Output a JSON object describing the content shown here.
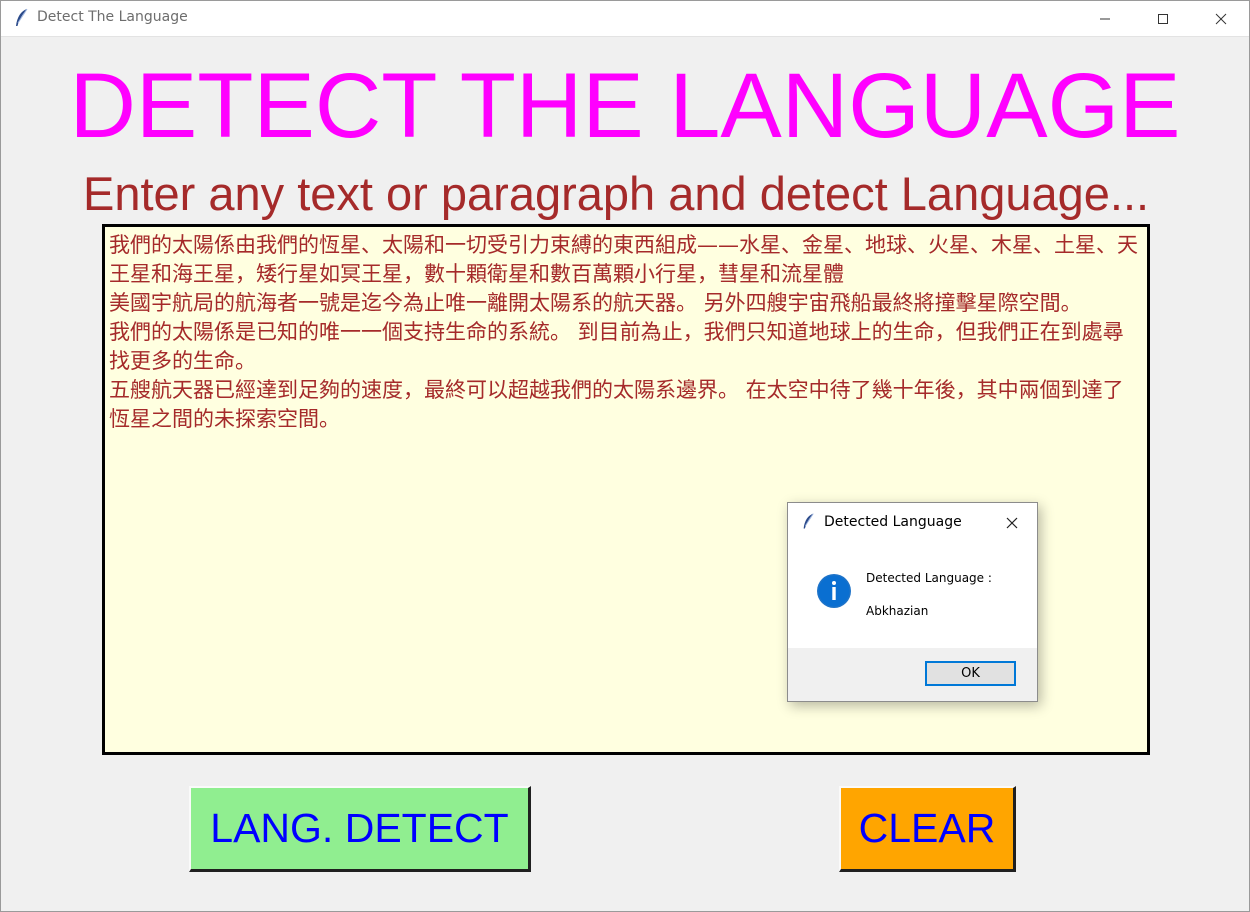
{
  "window": {
    "title": "Detect The Language",
    "icon": "feather-icon"
  },
  "app": {
    "heading": "DETECT THE LANGUAGE",
    "subheading": "Enter any text or paragraph and detect Language...",
    "text_input_value": "我們的太陽係由我們的恆星、太陽和一切受引力束縛的東西組成——水星、金星、地球、火星、木星、土星、天王星和海王星，矮行星如冥王星，數十顆衛星和數百萬顆小行星，彗星和流星體\n美國宇航局的航海者一號是迄今為止唯一離開太陽系的航天器。 另外四艘宇宙飛船最終將撞擊星際空間。\n我們的太陽係是已知的唯一一個支持生命的系統。 到目前為止，我們只知道地球上的生命，但我們正在到處尋找更多的生命。\n五艘航天器已經達到足夠的速度，最終可以超越我們的太陽系邊界。 在太空中待了幾十年後，其中兩個到達了恆星之間的未探索空間。",
    "detect_button_label": "LANG. DETECT",
    "clear_button_label": "CLEAR"
  },
  "dialog": {
    "title": "Detected Language",
    "message_label": "Detected Language :",
    "message_value": "Abkhazian",
    "ok_label": "OK",
    "icon": "info-icon"
  },
  "colors": {
    "heading": "#ff00ff",
    "subheading": "#a52a2a",
    "text": "#a52a2a",
    "textarea_bg": "#ffffe0",
    "detect_button_bg": "#90ee90",
    "clear_button_bg": "#ffa500",
    "button_text": "#0000ff",
    "window_bg": "#f0f0f0"
  }
}
